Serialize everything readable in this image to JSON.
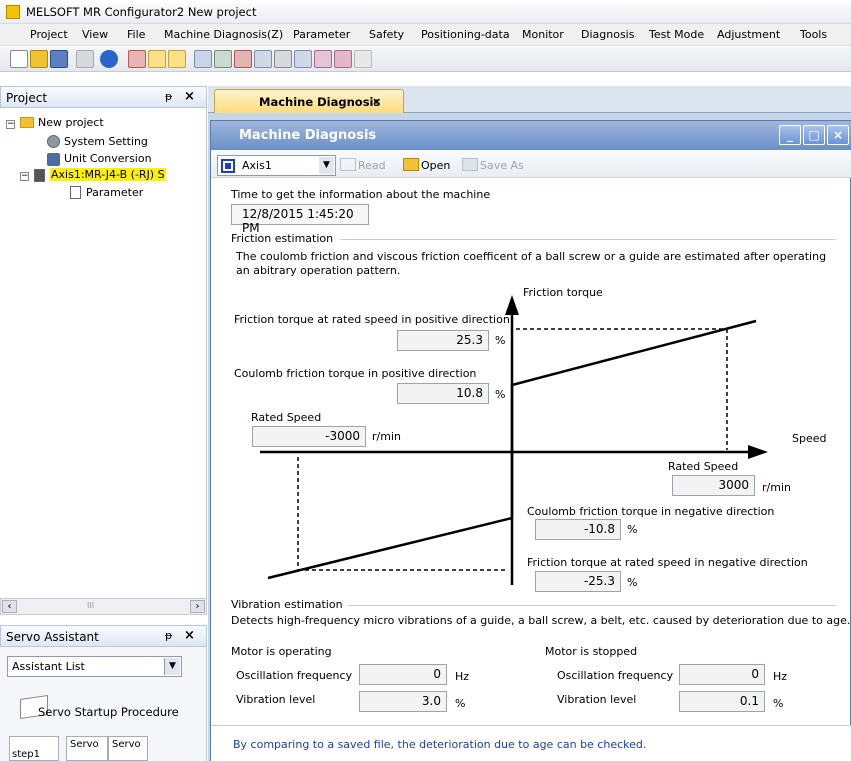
{
  "window": {
    "title": "MELSOFT MR Configurator2 New project"
  },
  "menu": [
    "Project",
    "View",
    "File",
    "Machine Diagnosis(Z)",
    "Parameter",
    "Safety",
    "Positioning-data",
    "Monitor",
    "Diagnosis",
    "Test Mode",
    "Adjustment",
    "Tools"
  ],
  "project_panel": {
    "title": "Project",
    "pin": "ᵽ",
    "close": "×",
    "tree": {
      "root": "New project",
      "system_setting": "System Setting",
      "unit_conversion": "Unit Conversion",
      "axis": "Axis1:MR-J4-B (-RJ) S",
      "parameter": "Parameter"
    },
    "scroll_mark": "III"
  },
  "servo_panel": {
    "title": "Servo Assistant",
    "pin": "ᵽ",
    "close": "×",
    "select_value": "Assistant List",
    "procedure": "Servo Startup Procedure",
    "tabs": [
      "step1",
      "Servo",
      "Servo"
    ]
  },
  "doc_tab": {
    "label": "Machine Diagnosis",
    "close": "×"
  },
  "mdi": {
    "title": "Machine Diagnosis",
    "toolbar": {
      "axis": "Axis1",
      "read": "Read",
      "open": "Open",
      "save_as": "Save As"
    },
    "time_label": "Time to get the information about the machine",
    "time_value": "12/8/2015 1:45:20 PM",
    "friction": {
      "group": "Friction estimation",
      "desc": "The coulomb friction and viscous friction coefficent of a ball screw or a guide are estimated after operating an abitrary operation pattern.",
      "axis_y": "Friction torque",
      "axis_x": "Speed",
      "pos_rated_label": "Friction torque at rated speed in positive direction",
      "pos_rated_value": "25.3",
      "pos_coulomb_label": "Coulomb friction torque in positive direction",
      "pos_coulomb_value": "10.8",
      "neg_rated_speed_label": "Rated Speed",
      "neg_rated_speed_value": "-3000",
      "pos_rated_speed_label": "Rated Speed",
      "pos_rated_speed_value": "3000",
      "neg_coulomb_label": "Coulomb friction torque in negative direction",
      "neg_coulomb_value": "-10.8",
      "neg_rated_label": "Friction torque at rated speed in negative direction",
      "neg_rated_value": "-25.3",
      "unit_pct": "%",
      "unit_speed": "r/min"
    },
    "vibration": {
      "group": "Vibration estimation",
      "desc": "Detects high-frequency micro vibrations of a guide, a ball screw, a belt, etc. caused by deterioration due to age.",
      "operating": {
        "title": "Motor is operating",
        "osc_label": "Oscillation frequency",
        "osc_value": "0",
        "osc_unit": "Hz",
        "level_label": "Vibration level",
        "level_value": "3.0",
        "level_unit": "%"
      },
      "stopped": {
        "title": "Motor is stopped",
        "osc_label": "Oscillation frequency",
        "osc_value": "0",
        "osc_unit": "Hz",
        "level_label": "Vibration level",
        "level_value": "0.1",
        "level_unit": "%"
      }
    },
    "note": "By comparing to a saved file, the deterioration due to age can be checked."
  }
}
